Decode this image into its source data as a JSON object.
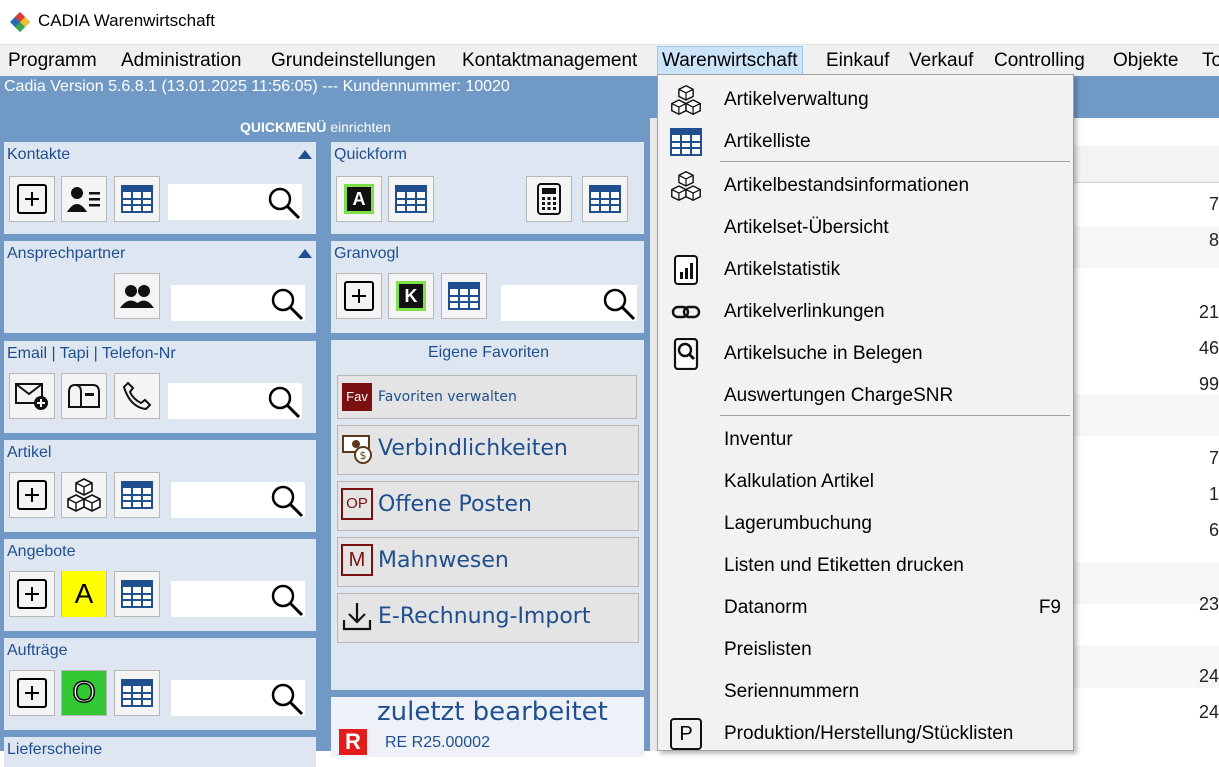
{
  "window": {
    "title": "CADIA Warenwirtschaft"
  },
  "menubar": {
    "items": [
      "Programm",
      "Administration",
      "Grundeinstellungen",
      "Kontaktmanagement",
      "Warenwirtschaft",
      "Einkauf",
      "Verkauf",
      "Controlling",
      "Objekte",
      "To"
    ],
    "active": "Warenwirtschaft"
  },
  "version_text": "Cadia Version 5.6.8.1  (13.01.2025 11:56:05) --- Kundennummer: 10020",
  "quickmenu": {
    "title_bold": "QUICKMENÜ",
    "title_rest": " einrichten"
  },
  "panels": {
    "kontakte": "Kontakte",
    "ansprechpartner": "Ansprechpartner",
    "email": "Email | Tapi  | Telefon-Nr",
    "artikel": "Artikel",
    "angebote": "Angebote",
    "auftraege": "Aufträge",
    "lieferscheine": "Lieferscheine",
    "quickform": "Quickform",
    "granvogl": "Granvogl",
    "favoriten": "Eigene Favoriten"
  },
  "letters": {
    "quickform": "A",
    "granvogl": "K",
    "angebote": "A",
    "auftraege": "O"
  },
  "favorites": {
    "manage_badge": "Fav",
    "manage_label": "Favoriten verwalten",
    "items": [
      "Verbindlichkeiten",
      "Offene Posten",
      "Mahnwesen",
      "E-Rechnung-Import"
    ],
    "op_badge": "OP",
    "m_badge": "M"
  },
  "recent": {
    "title": "zuletzt  bearbeitet",
    "badge": "R",
    "entry": "RE R25.00002"
  },
  "right_numbers": [
    "7",
    "8",
    "21",
    "46",
    "99",
    "7",
    "1",
    "6",
    "23",
    "24",
    "24"
  ],
  "dropdown": {
    "items": [
      {
        "label": "Artikelverwaltung",
        "icon": "cubes-icon"
      },
      {
        "label": "Artikelliste",
        "icon": "table-icon"
      },
      {
        "label": "Artikelbestandsinformationen",
        "icon": "cubes-icon"
      },
      {
        "label": "Artikelset-Übersicht",
        "icon": ""
      },
      {
        "label": "Artikelstatistik",
        "icon": "chart-icon"
      },
      {
        "label": "Artikelverlinkungen",
        "icon": "link-icon"
      },
      {
        "label": "Artikelsuche in Belegen",
        "icon": "search-doc-icon"
      },
      {
        "label": "Auswertungen ChargeSNR",
        "icon": ""
      },
      {
        "label": "Inventur",
        "icon": ""
      },
      {
        "label": "Kalkulation Artikel",
        "icon": ""
      },
      {
        "label": "Lagerumbuchung",
        "icon": ""
      },
      {
        "label": "Listen und Etiketten drucken",
        "icon": ""
      },
      {
        "label": "Datanorm",
        "icon": "",
        "shortcut": "F9"
      },
      {
        "label": "Preislisten",
        "icon": ""
      },
      {
        "label": "Seriennummern",
        "icon": ""
      },
      {
        "label": "Produktion/Herstellung/Stücklisten",
        "icon": "p-icon"
      }
    ],
    "p_letter": "P"
  },
  "colors": {
    "accent_blue": "#1f4f8f",
    "panel_bg": "#dde6f1",
    "main_bg": "#7199c6",
    "menu_highlight": "#cce4f7"
  }
}
